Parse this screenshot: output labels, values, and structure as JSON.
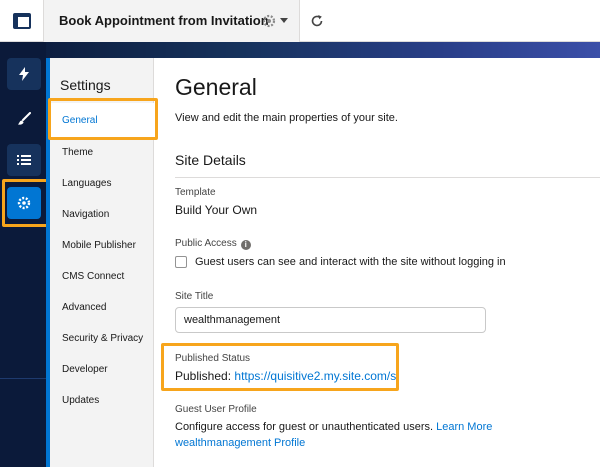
{
  "topbar": {
    "app_icon": "layout-icon",
    "title": "Book Appointment from Invitation",
    "gear_icon": "gear-icon",
    "dropdown_icon": "caret-down-icon",
    "refresh_icon": "refresh-icon"
  },
  "rail": {
    "items": [
      {
        "icon": "bolt-icon",
        "active": false
      },
      {
        "icon": "brush-icon",
        "active": false
      },
      {
        "icon": "list-icon",
        "active": false
      },
      {
        "icon": "gear-icon",
        "active": true
      }
    ]
  },
  "settings": {
    "title": "Settings",
    "items": [
      {
        "label": "General",
        "active": true
      },
      {
        "label": "Theme"
      },
      {
        "label": "Languages"
      },
      {
        "label": "Navigation"
      },
      {
        "label": "Mobile Publisher"
      },
      {
        "label": "CMS Connect"
      },
      {
        "label": "Advanced"
      },
      {
        "label": "Security & Privacy"
      },
      {
        "label": "Developer"
      },
      {
        "label": "Updates"
      }
    ]
  },
  "main": {
    "title": "General",
    "subtitle": "View and edit the main properties of your site.",
    "section_title": "Site Details",
    "template_label": "Template",
    "template_value": "Build Your Own",
    "public_access_label": "Public Access",
    "public_access_checkbox_label": "Guest users can see and interact with the site without logging in",
    "public_access_checked": false,
    "site_title_label": "Site Title",
    "site_title_value": "wealthmanagement",
    "published_status_label": "Published Status",
    "published_prefix": "Published:",
    "published_url": "https://quisitive2.my.site.com/s",
    "guest_profile_label": "Guest User Profile",
    "guest_profile_text": "Configure access for guest or unauthenticated users.",
    "guest_profile_link_1": "Learn More",
    "guest_profile_link_2": "wealthmanagement Profile"
  },
  "colors": {
    "accent": "#0176d3",
    "highlight": "#f7a51c",
    "rail_bg": "#0b1a3a"
  }
}
